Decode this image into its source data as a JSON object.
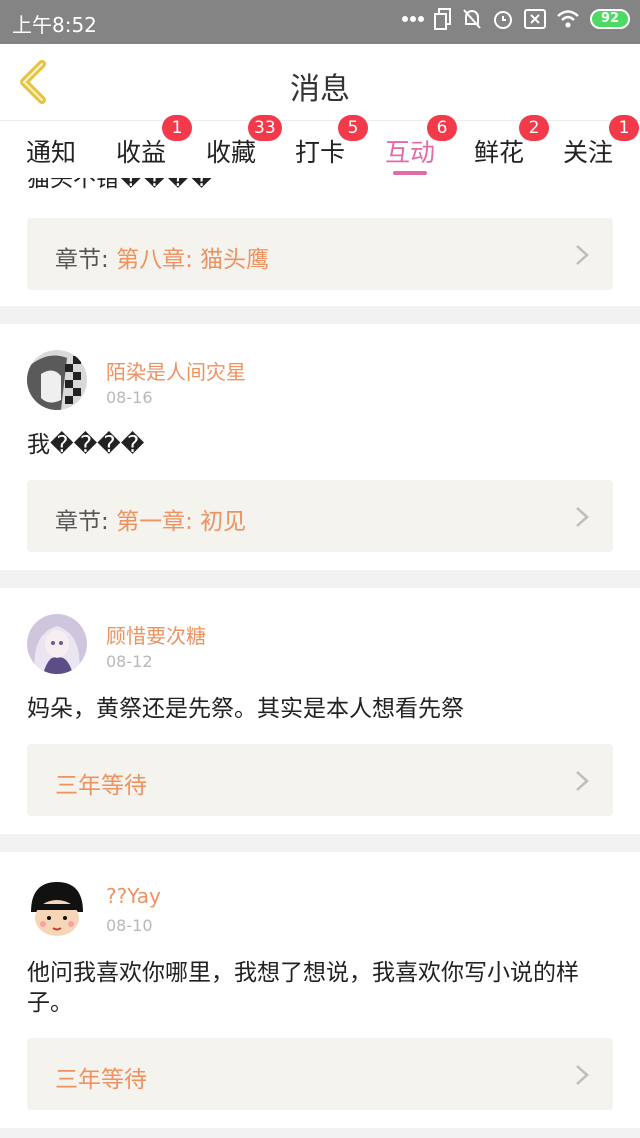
{
  "status_bar": {
    "time": "上午8:52",
    "battery": "92",
    "icons": [
      "more-dots-icon",
      "sim-icon",
      "bell-muted-icon",
      "alarm-icon",
      "sim-off-icon",
      "wifi-icon",
      "battery-icon"
    ]
  },
  "header": {
    "title": "消息",
    "back_icon": "back-chevron-icon"
  },
  "tabs": [
    {
      "label": "通知",
      "badge": ""
    },
    {
      "label": "收益",
      "badge": "1"
    },
    {
      "label": "收藏",
      "badge": "33"
    },
    {
      "label": "打卡",
      "badge": "5"
    },
    {
      "label": "互动",
      "badge": "6",
      "active": true
    },
    {
      "label": "鲜花",
      "badge": "2"
    },
    {
      "label": "关注",
      "badge": "1"
    }
  ],
  "top_partial": {
    "message": "猫头不错����",
    "chapter_prefix": "章节: ",
    "chapter": "第八章: 猫头鹰"
  },
  "items": [
    {
      "user": "陌染是人间灾星",
      "date": "08-16",
      "message": "我����",
      "chapter_prefix": "章节: ",
      "chapter": "第一章: 初见"
    },
    {
      "user": "顾惜要次糖",
      "date": "08-12",
      "message": "妈朵，黄祭还是先祭。其实是本人想看先祭",
      "chapter_prefix": "",
      "chapter": "三年等待"
    },
    {
      "user": "??Yay",
      "date": "08-10",
      "message": "他问我喜欢你哪里，我想了想说，我喜欢你写小说的样子。",
      "chapter_prefix": "",
      "chapter": "三年等待"
    }
  ],
  "colors": {
    "accent_pink": "#e26ba5",
    "accent_orange": "#ee9260",
    "badge_red": "#f23a4a",
    "back_yellow": "#e8c341"
  }
}
